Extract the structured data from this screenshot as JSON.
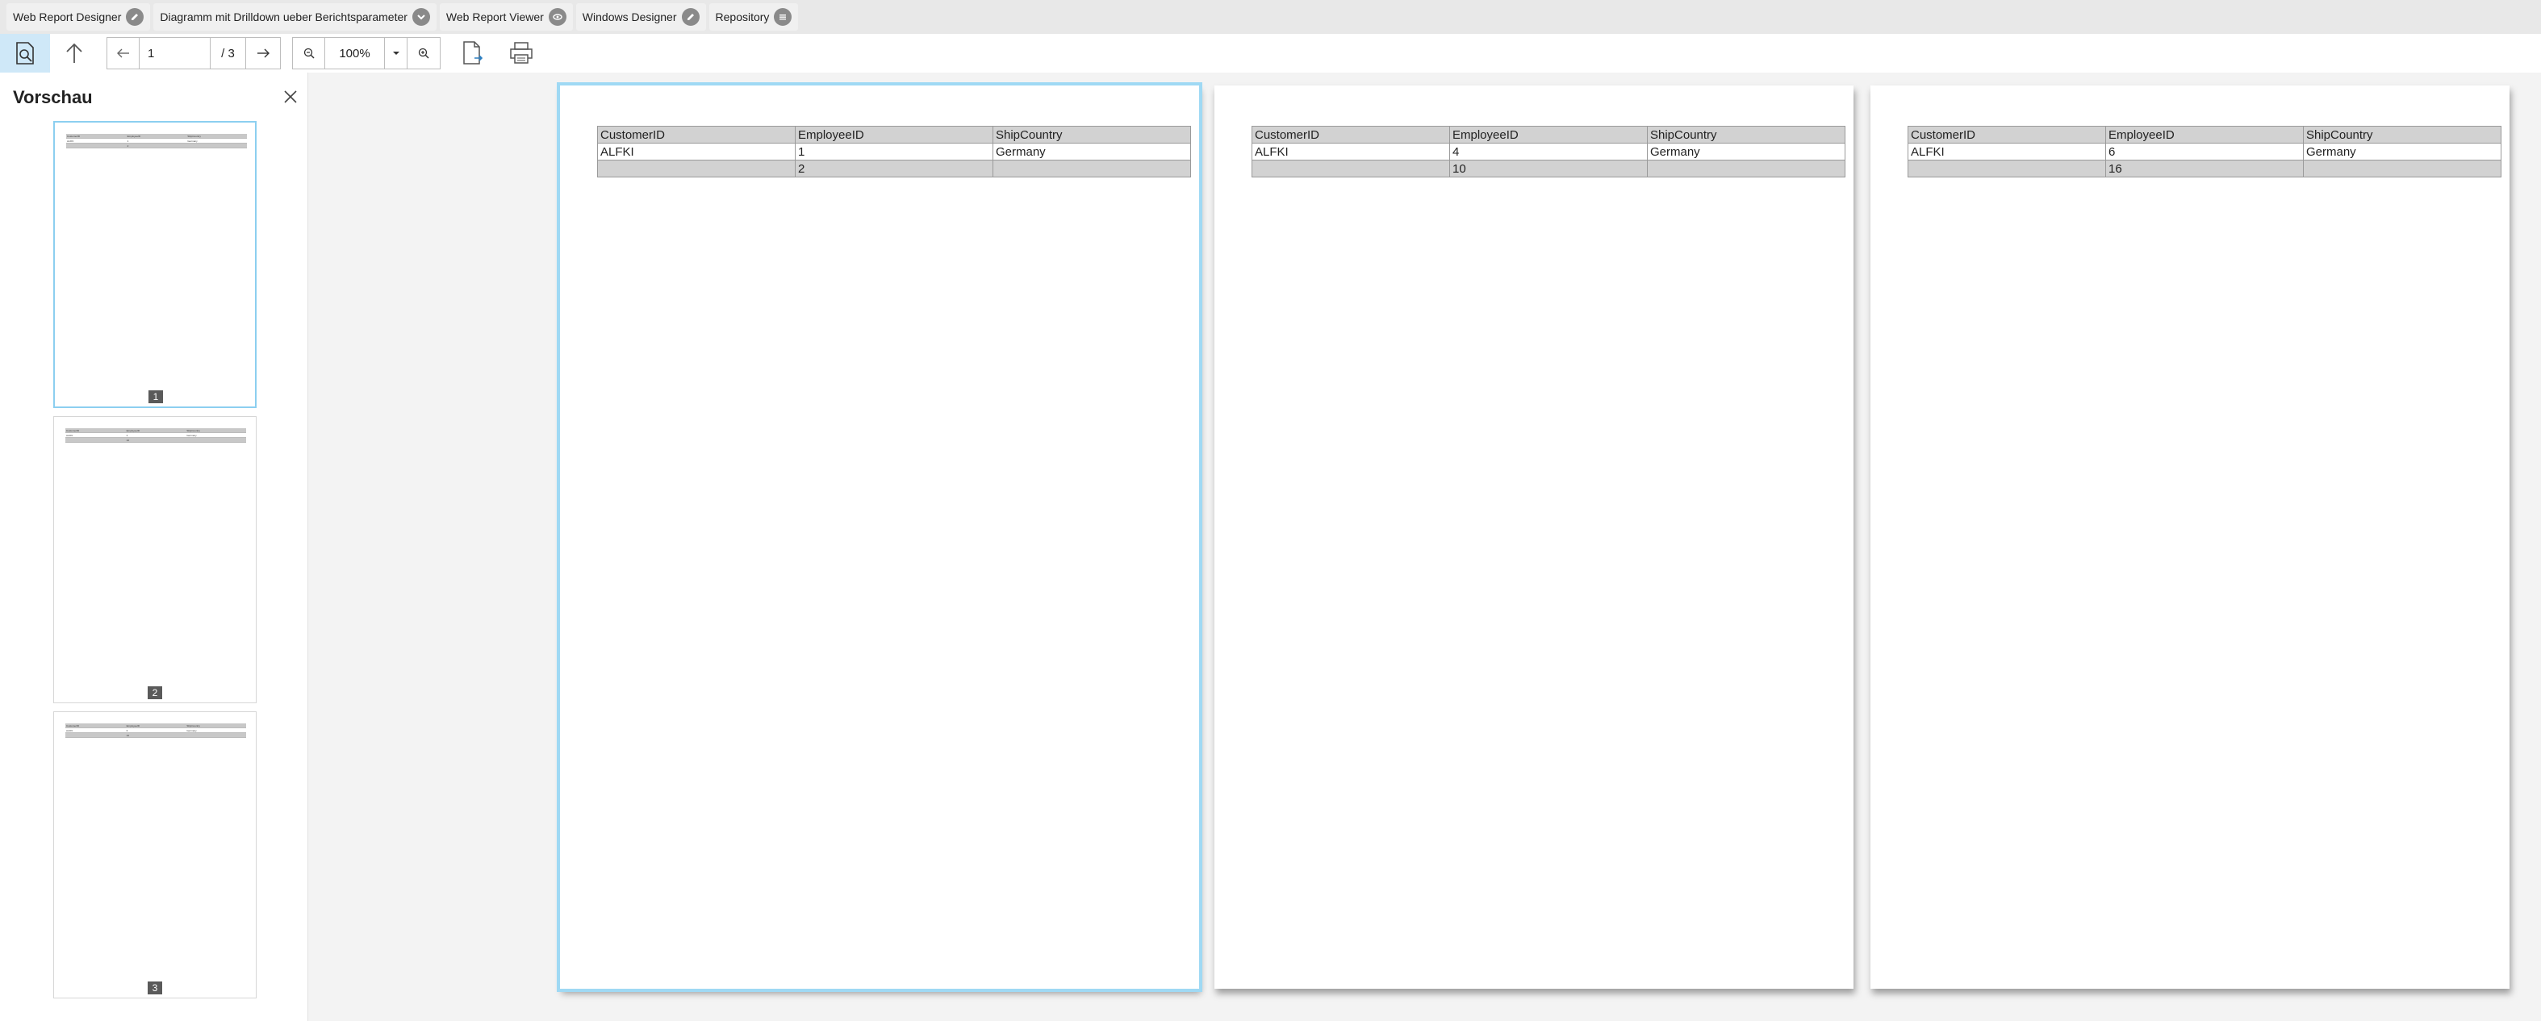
{
  "topbar": {
    "tabs": [
      {
        "label": "Web Report Designer",
        "icon": "pencil-icon"
      },
      {
        "label": "Diagramm mit Drilldown ueber Berichtsparameter",
        "icon": "chevron-down-icon"
      },
      {
        "label": "Web Report Viewer",
        "icon": "eye-icon"
      },
      {
        "label": "Windows Designer",
        "icon": "pencil-icon"
      },
      {
        "label": "Repository",
        "icon": "list-icon"
      }
    ]
  },
  "toolbar": {
    "page_value": "1",
    "page_total": "/ 3",
    "zoom_value": "100%"
  },
  "sidebar": {
    "title": "Vorschau",
    "thumbnails": [
      {
        "num": "1"
      },
      {
        "num": "2"
      },
      {
        "num": "3"
      }
    ]
  },
  "report": {
    "headers": [
      "CustomerID",
      "EmployeeID",
      "ShipCountry"
    ],
    "pages": [
      {
        "row": [
          "ALFKI",
          "1",
          "Germany"
        ],
        "sum": [
          "",
          "2",
          ""
        ]
      },
      {
        "row": [
          "ALFKI",
          "4",
          "Germany"
        ],
        "sum": [
          "",
          "10",
          ""
        ]
      },
      {
        "row": [
          "ALFKI",
          "6",
          "Germany"
        ],
        "sum": [
          "",
          "16",
          ""
        ]
      }
    ]
  },
  "colors": {
    "accent": "#9fd9f4",
    "toolbar_active": "#cfe8f8",
    "header_cell": "#d2d2d2"
  }
}
